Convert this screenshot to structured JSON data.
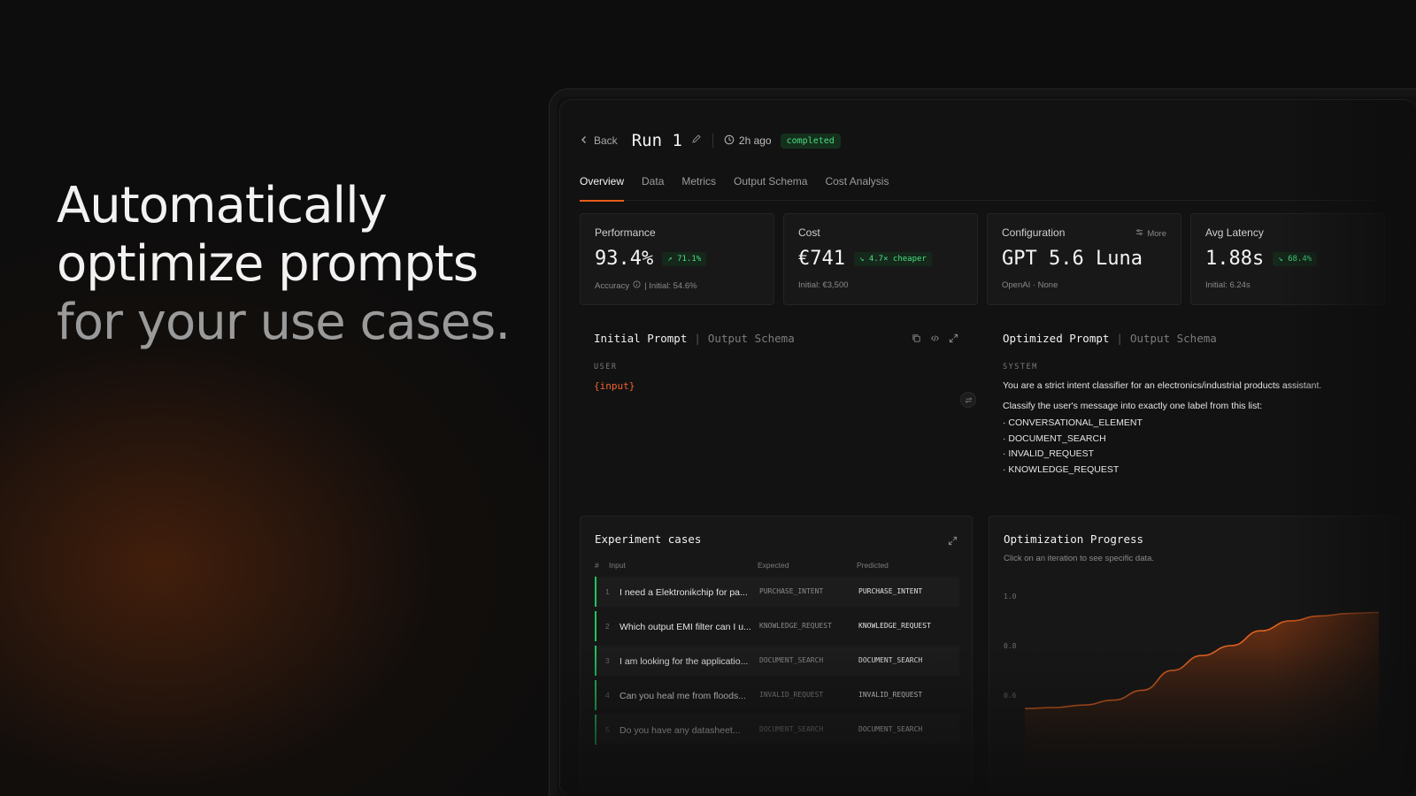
{
  "hero": {
    "line1": "Automatically",
    "line2": "optimize prompts",
    "line3": "for your use cases."
  },
  "header": {
    "back_label": "Back",
    "run_title": "Run 1",
    "time_ago": "2h ago",
    "status": "completed"
  },
  "tabs": [
    {
      "label": "Overview",
      "active": true
    },
    {
      "label": "Data",
      "active": false
    },
    {
      "label": "Metrics",
      "active": false
    },
    {
      "label": "Output Schema",
      "active": false
    },
    {
      "label": "Cost Analysis",
      "active": false
    }
  ],
  "cards": {
    "performance": {
      "label": "Performance",
      "value": "93.4%",
      "delta": "↗ 71.1%",
      "sub_metric": "Accuracy",
      "sub_initial": "| Initial: 54.6%"
    },
    "cost": {
      "label": "Cost",
      "value": "€741",
      "delta": "↘ 4.7× cheaper",
      "sub": "Initial: €3,500"
    },
    "configuration": {
      "label": "Configuration",
      "more": "More",
      "value": "GPT 5.6 Luna",
      "sub": "OpenAI · None"
    },
    "latency": {
      "label": "Avg Latency",
      "value": "1.88s",
      "delta": "↘ 68.4%",
      "sub": "Initial: 6.24s"
    }
  },
  "initial_prompt": {
    "title": "Initial Prompt",
    "separator": "|",
    "alt_tab": "Output Schema",
    "role": "USER",
    "content": "{input}"
  },
  "optimized_prompt": {
    "title": "Optimized Prompt",
    "separator": "|",
    "alt_tab": "Output Schema",
    "role": "SYSTEM",
    "line1": "You are a strict intent classifier for an electronics/industrial products assistant.",
    "line2": "Classify the user's message into exactly one label from this list:",
    "labels": [
      "· CONVERSATIONAL_ELEMENT",
      "· DOCUMENT_SEARCH",
      "· INVALID_REQUEST",
      "· KNOWLEDGE_REQUEST"
    ]
  },
  "experiment": {
    "title": "Experiment cases",
    "columns": {
      "num": "#",
      "input": "Input",
      "expected": "Expected",
      "predicted": "Predicted"
    },
    "rows": [
      {
        "num": "1",
        "input": "I need a Elektronikchip for pa...",
        "expected": "PURCHASE_INTENT",
        "predicted": "PURCHASE_INTENT"
      },
      {
        "num": "2",
        "input": "Which output EMI filter can I u...",
        "expected": "KNOWLEDGE_REQUEST",
        "predicted": "KNOWLEDGE_REQUEST"
      },
      {
        "num": "3",
        "input": "I am looking for the applicatio...",
        "expected": "DOCUMENT_SEARCH",
        "predicted": "DOCUMENT_SEARCH"
      },
      {
        "num": "4",
        "input": "Can you heal me from floods...",
        "expected": "INVALID_REQUEST",
        "predicted": "INVALID_REQUEST"
      },
      {
        "num": "5",
        "input": "Do you have any datasheet...",
        "expected": "DOCUMENT_SEARCH",
        "predicted": "DOCUMENT_SEARCH"
      }
    ]
  },
  "optimization": {
    "title": "Optimization Progress",
    "subtitle": "Click on an iteration to see specific data."
  },
  "chart_data": {
    "type": "area",
    "title": "Optimization Progress",
    "y_ticks": [
      "1.0",
      "0.8",
      "0.6"
    ],
    "ylim": [
      0.5,
      1.0
    ],
    "x": [
      0,
      1,
      2,
      3,
      4,
      5,
      6,
      7,
      8,
      9,
      10,
      11,
      12
    ],
    "values": [
      0.546,
      0.55,
      0.56,
      0.58,
      0.62,
      0.7,
      0.76,
      0.8,
      0.86,
      0.9,
      0.92,
      0.93,
      0.934
    ],
    "grid": false,
    "colors": {
      "line": "#e2621f",
      "fill_top": "#7a3210"
    }
  }
}
